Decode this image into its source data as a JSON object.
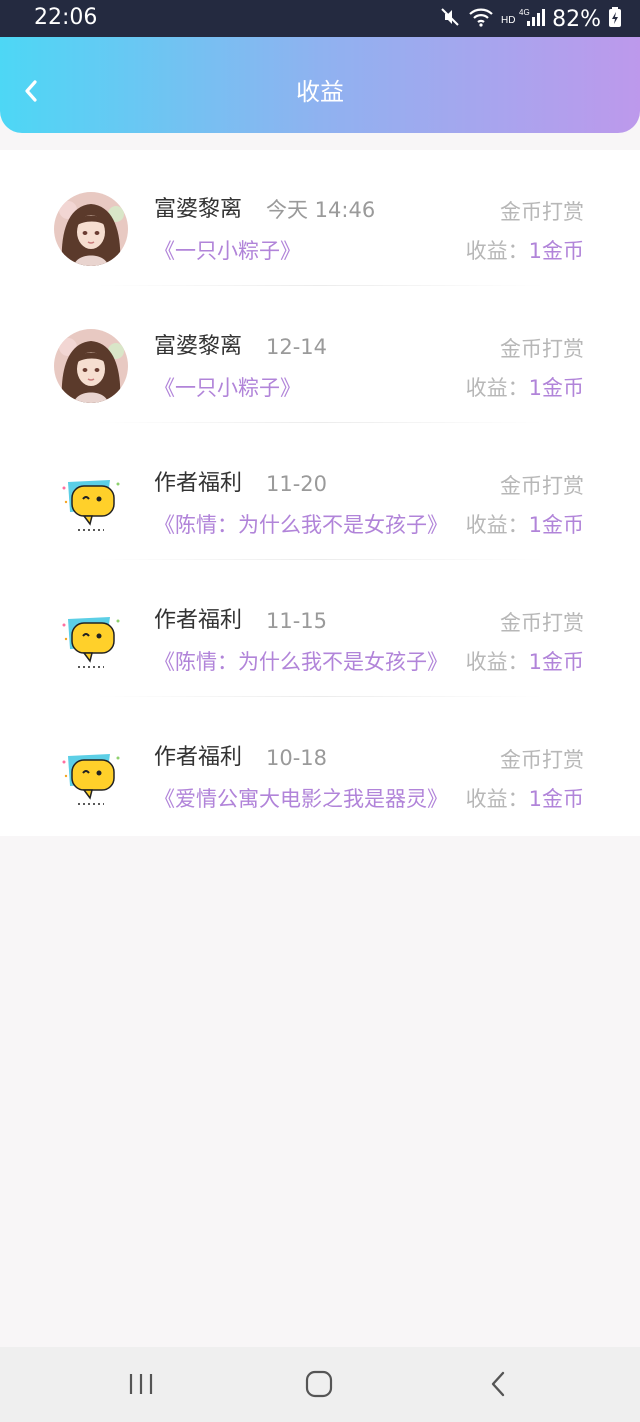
{
  "status": {
    "time": "22:06",
    "battery": "82%",
    "icons": [
      "mute-icon",
      "wifi-icon",
      "hd-4g-signal-icon",
      "battery-icon"
    ]
  },
  "header": {
    "title": "收益",
    "back_icon": "chevron-left-icon"
  },
  "records": [
    {
      "avatar": "portrait-girl",
      "name": "富婆黎离",
      "date": "今天 14:46",
      "type": "金币打赏",
      "book": "《一只小粽子》",
      "earning_label": "收益：",
      "earning_value": "1金币"
    },
    {
      "avatar": "portrait-girl",
      "name": "富婆黎离",
      "date": "12-14",
      "type": "金币打赏",
      "book": "《一只小粽子》",
      "earning_label": "收益：",
      "earning_value": "1金币"
    },
    {
      "avatar": "yellow-chat-bubble",
      "name": "作者福利",
      "date": "11-20",
      "type": "金币打赏",
      "book": "《陈情：为什么我不是女孩子》",
      "earning_label": "收益：",
      "earning_value": "1金币"
    },
    {
      "avatar": "yellow-chat-bubble",
      "name": "作者福利",
      "date": "11-15",
      "type": "金币打赏",
      "book": "《陈情：为什么我不是女孩子》",
      "earning_label": "收益：",
      "earning_value": "1金币"
    },
    {
      "avatar": "yellow-chat-bubble",
      "name": "作者福利",
      "date": "10-18",
      "type": "金币打赏",
      "book": "《爱情公寓大电影之我是器灵》",
      "earning_label": "收益：",
      "earning_value": "1金币"
    }
  ],
  "navbar": {
    "icons": [
      "recent-apps-icon",
      "home-icon",
      "back-icon"
    ]
  },
  "colors": {
    "accent": "#b184d9",
    "header_start": "#4dd7f5",
    "header_end": "#bd99ec",
    "muted": "#b7b7b7"
  }
}
